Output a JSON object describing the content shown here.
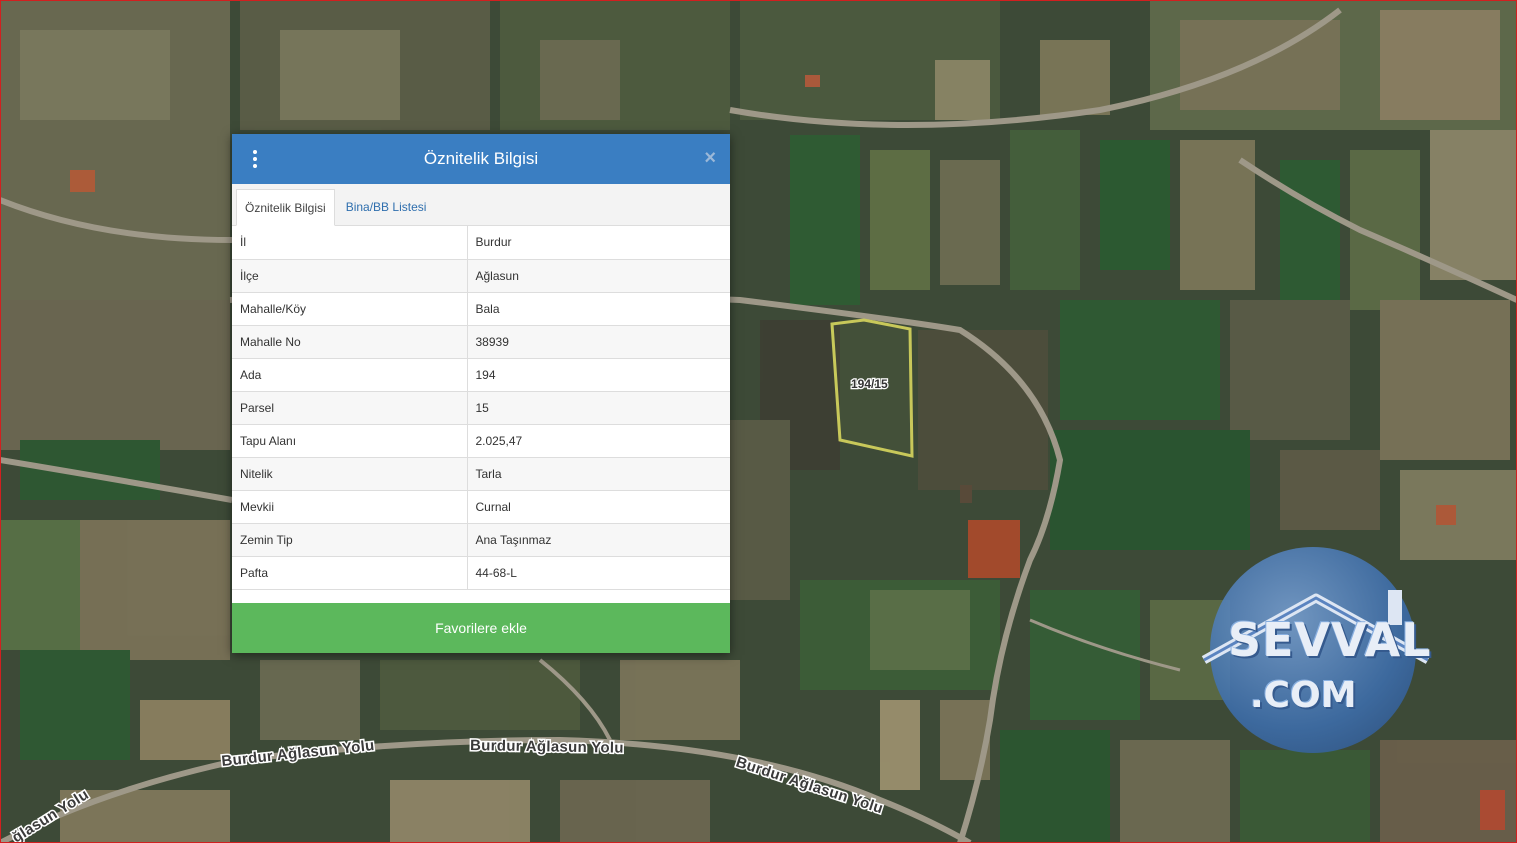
{
  "map": {
    "parcel_label": "194/15",
    "road_labels": [
      "Burdur Ağlasun Yolu",
      "Burdur Ağlasun Yolu",
      "Burdur Ağlasun Yolu",
      "ğlasun Yolu"
    ]
  },
  "panel": {
    "title": "Öznitelik Bilgisi",
    "tabs": [
      {
        "label": "Öznitelik Bilgisi",
        "active": true
      },
      {
        "label": "Bina/BB Listesi",
        "active": false
      }
    ],
    "rows": [
      {
        "key": "İl",
        "value": "Burdur"
      },
      {
        "key": "İlçe",
        "value": "Ağlasun"
      },
      {
        "key": "Mahalle/Köy",
        "value": "Bala"
      },
      {
        "key": "Mahalle No",
        "value": "38939"
      },
      {
        "key": "Ada",
        "value": "194"
      },
      {
        "key": "Parsel",
        "value": "15"
      },
      {
        "key": "Tapu Alanı",
        "value": "2.025,47"
      },
      {
        "key": "Nitelik",
        "value": "Tarla"
      },
      {
        "key": "Mevkii",
        "value": "Curnal"
      },
      {
        "key": "Zemin Tip",
        "value": "Ana Taşınmaz"
      },
      {
        "key": "Pafta",
        "value": "44-68-L"
      }
    ],
    "favorite_label": "Favorilere ekle",
    "close_symbol": "×"
  },
  "watermark": {
    "line1": "SEVVAL",
    "line2": ".COM"
  },
  "colors": {
    "header": "#3a7ec2",
    "favorite_button": "#5cb85c",
    "frame": "#d21f1f",
    "parcel_outline": "#c8c85a"
  }
}
